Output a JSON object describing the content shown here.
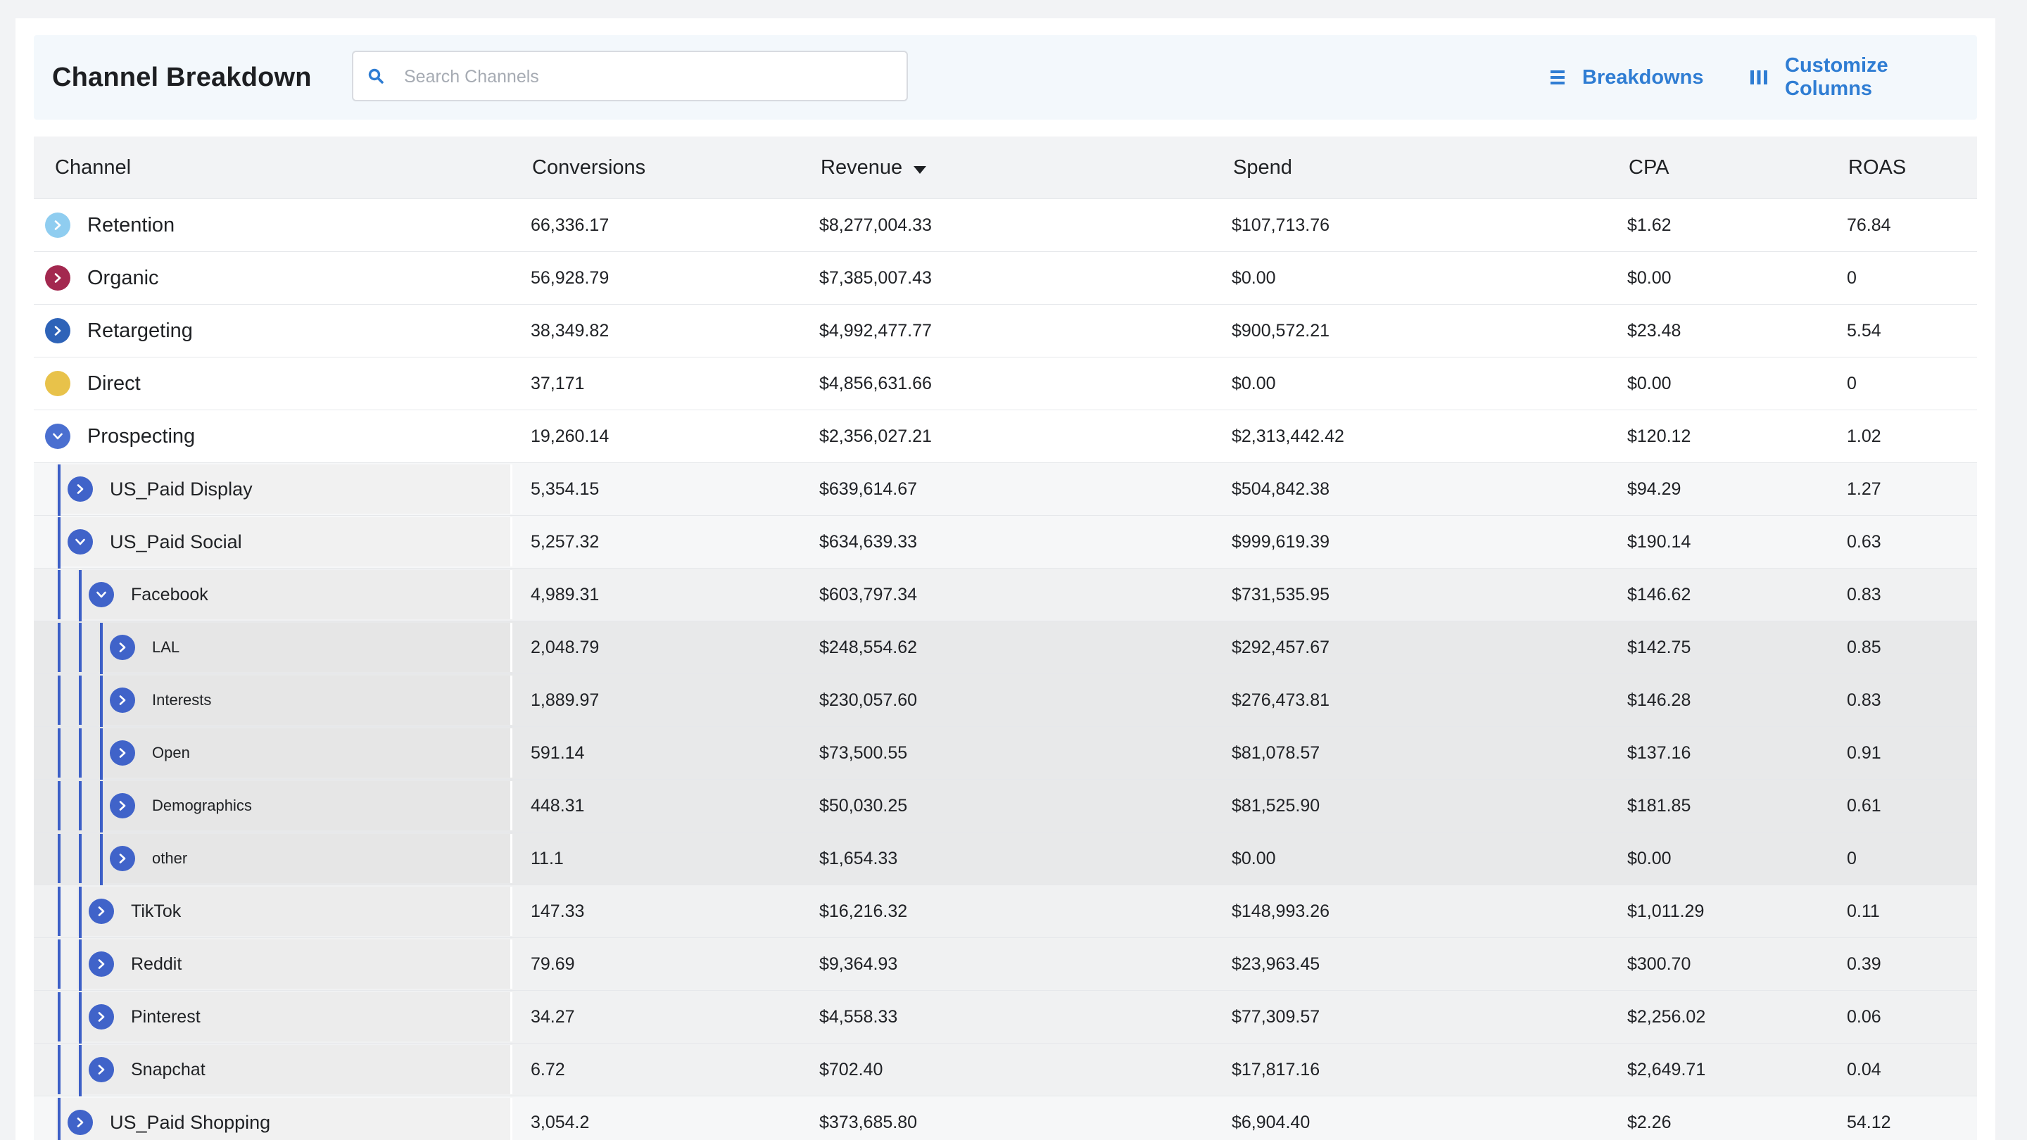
{
  "header": {
    "title": "Channel Breakdown",
    "search_placeholder": "Search Channels",
    "breakdowns_label": "Breakdowns",
    "customize_label": "Customize Columns"
  },
  "columns": [
    "Channel",
    "Conversions",
    "Revenue",
    "Spend",
    "CPA",
    "ROAS"
  ],
  "sort": {
    "column": "Revenue",
    "direction": "desc"
  },
  "colors": {
    "accent": "#2f7dd3",
    "tree_blue": "#3c5fc7"
  },
  "rows": [
    {
      "name": "Retention",
      "level": 0,
      "state": "collapsed",
      "color": "#8fcdf0",
      "conversions": "66,336.17",
      "revenue": "$8,277,004.33",
      "spend": "$107,713.76",
      "cpa": "$1.62",
      "roas": "76.84"
    },
    {
      "name": "Organic",
      "level": 0,
      "state": "collapsed",
      "color": "#a3284f",
      "conversions": "56,928.79",
      "revenue": "$7,385,007.43",
      "spend": "$0.00",
      "cpa": "$0.00",
      "roas": "0"
    },
    {
      "name": "Retargeting",
      "level": 0,
      "state": "collapsed",
      "color": "#2e63b8",
      "conversions": "38,349.82",
      "revenue": "$4,992,477.77",
      "spend": "$900,572.21",
      "cpa": "$23.48",
      "roas": "5.54"
    },
    {
      "name": "Direct",
      "level": 0,
      "state": "none",
      "color": "#e8c24a",
      "conversions": "37,171",
      "revenue": "$4,856,631.66",
      "spend": "$0.00",
      "cpa": "$0.00",
      "roas": "0"
    },
    {
      "name": "Prospecting",
      "level": 0,
      "state": "expanded",
      "color": "#4a6fd0",
      "conversions": "19,260.14",
      "revenue": "$2,356,027.21",
      "spend": "$2,313,442.42",
      "cpa": "$120.12",
      "roas": "1.02"
    },
    {
      "name": "US_Paid Display",
      "level": 1,
      "state": "collapsed",
      "color": "#4063c9",
      "conversions": "5,354.15",
      "revenue": "$639,614.67",
      "spend": "$504,842.38",
      "cpa": "$94.29",
      "roas": "1.27"
    },
    {
      "name": "US_Paid Social",
      "level": 1,
      "state": "expanded",
      "color": "#4063c9",
      "conversions": "5,257.32",
      "revenue": "$634,639.33",
      "spend": "$999,619.39",
      "cpa": "$190.14",
      "roas": "0.63"
    },
    {
      "name": "Facebook",
      "level": 2,
      "state": "expanded",
      "color": "#4063c9",
      "conversions": "4,989.31",
      "revenue": "$603,797.34",
      "spend": "$731,535.95",
      "cpa": "$146.62",
      "roas": "0.83"
    },
    {
      "name": "LAL",
      "level": 3,
      "state": "collapsed",
      "color": "#4063c9",
      "conversions": "2,048.79",
      "revenue": "$248,554.62",
      "spend": "$292,457.67",
      "cpa": "$142.75",
      "roas": "0.85"
    },
    {
      "name": "Interests",
      "level": 3,
      "state": "collapsed",
      "color": "#4063c9",
      "conversions": "1,889.97",
      "revenue": "$230,057.60",
      "spend": "$276,473.81",
      "cpa": "$146.28",
      "roas": "0.83"
    },
    {
      "name": "Open",
      "level": 3,
      "state": "collapsed",
      "color": "#4063c9",
      "conversions": "591.14",
      "revenue": "$73,500.55",
      "spend": "$81,078.57",
      "cpa": "$137.16",
      "roas": "0.91"
    },
    {
      "name": "Demographics",
      "level": 3,
      "state": "collapsed",
      "color": "#4063c9",
      "conversions": "448.31",
      "revenue": "$50,030.25",
      "spend": "$81,525.90",
      "cpa": "$181.85",
      "roas": "0.61"
    },
    {
      "name": "other",
      "level": 3,
      "state": "collapsed",
      "color": "#4063c9",
      "conversions": "11.1",
      "revenue": "$1,654.33",
      "spend": "$0.00",
      "cpa": "$0.00",
      "roas": "0"
    },
    {
      "name": "TikTok",
      "level": 2,
      "state": "collapsed",
      "color": "#4063c9",
      "conversions": "147.33",
      "revenue": "$16,216.32",
      "spend": "$148,993.26",
      "cpa": "$1,011.29",
      "roas": "0.11"
    },
    {
      "name": "Reddit",
      "level": 2,
      "state": "collapsed",
      "color": "#4063c9",
      "conversions": "79.69",
      "revenue": "$9,364.93",
      "spend": "$23,963.45",
      "cpa": "$300.70",
      "roas": "0.39"
    },
    {
      "name": "Pinterest",
      "level": 2,
      "state": "collapsed",
      "color": "#4063c9",
      "conversions": "34.27",
      "revenue": "$4,558.33",
      "spend": "$77,309.57",
      "cpa": "$2,256.02",
      "roas": "0.06"
    },
    {
      "name": "Snapchat",
      "level": 2,
      "state": "collapsed",
      "color": "#4063c9",
      "conversions": "6.72",
      "revenue": "$702.40",
      "spend": "$17,817.16",
      "cpa": "$2,649.71",
      "roas": "0.04"
    },
    {
      "name": "US_Paid Shopping",
      "level": 1,
      "state": "collapsed",
      "color": "#4063c9",
      "conversions": "3,054.2",
      "revenue": "$373,685.80",
      "spend": "$6,904.40",
      "cpa": "$2.26",
      "roas": "54.12"
    }
  ]
}
